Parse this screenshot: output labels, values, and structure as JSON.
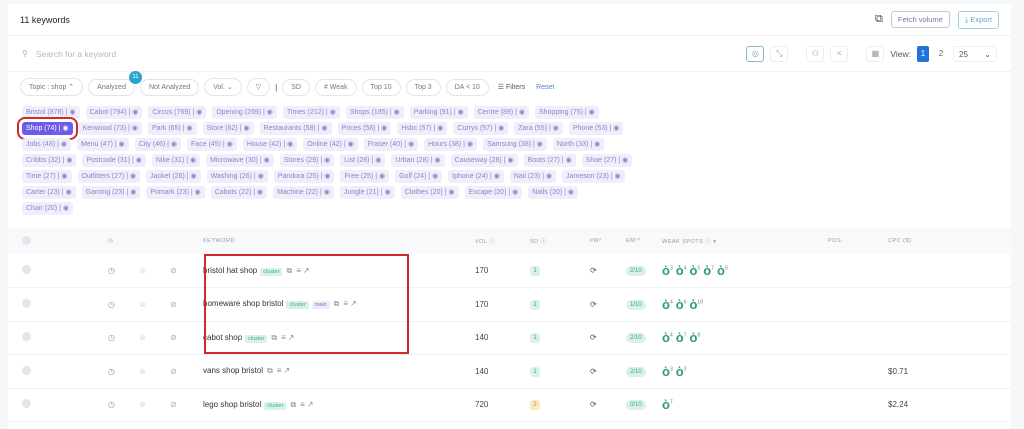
{
  "header": {
    "title": "11 keywords",
    "fetch_volume": "Fetch volume",
    "export": "Export"
  },
  "search": {
    "placeholder": "Search for a keyword"
  },
  "view": {
    "label": "View:",
    "pages": [
      "1",
      "2"
    ],
    "page_size": "25"
  },
  "filters": {
    "topic": "Topic : shop",
    "analyzed": "Analyzed",
    "analyzed_count": "11",
    "not_analyzed": "Not Analyzed",
    "vol": "Vol.",
    "sd": "SD",
    "weak": "# Weak",
    "top10": "Top 10",
    "top3": "Top 3",
    "da": "DA < 10",
    "filters": "Filters",
    "reset": "Reset"
  },
  "tags": [
    "Bristol (878) |",
    "Cabot (794) |",
    "Circus (769) |",
    "Opening (269) |",
    "Times (212) |",
    "Shops (185) |",
    "Parking (91) |",
    "Centre (89) |",
    "Shopping (75) |",
    "Shop (74) |",
    "Kenwood (73) |",
    "Park (65) |",
    "Store (62) |",
    "Restaurants (58) |",
    "Prices (58) |",
    "Hsbc (57) |",
    "Currys (57) |",
    "Zara (55) |",
    "Phone (53) |",
    "Jobs (48) |",
    "Menu (47) |",
    "City (46) |",
    "Face (45) |",
    "House (42) |",
    "Online (42) |",
    "Fraser (40) |",
    "Hours (38) |",
    "Samsung (38) |",
    "North (33) |",
    "Cribbs (32) |",
    "Postcode (31) |",
    "Nike (31) |",
    "Microwave (30) |",
    "Stores (29) |",
    "List (28) |",
    "Urban (28) |",
    "Causeway (28) |",
    "Boots (27) |",
    "Shoe (27) |",
    "Time (27) |",
    "Outfitters (27) |",
    "Jacket (26) |",
    "Washing (26) |",
    "Pandora (25) |",
    "Free (25) |",
    "Golf (24) |",
    "Iphone (24) |",
    "Nail (23) |",
    "Jameson (23) |",
    "Carter (23) |",
    "Gaming (23) |",
    "Primark (23) |",
    "Cabots (22) |",
    "Machine (22) |",
    "Jungle (21) |",
    "Clothes (20) |",
    "Escape (20) |",
    "Nails (20) |",
    "Chair (20) |"
  ],
  "active_tag": "Shop (74) |",
  "table": {
    "columns": {
      "keyword": "KEYWORD",
      "vol": "VOL ⓘ",
      "sd": "SD ⓘ",
      "w": "#W³",
      "em": "EM¹⁰",
      "weak_spots": "WEAK SPOTS ⓘ ▾",
      "pos": "POS.",
      "cpc": "CPC ($)"
    },
    "rows": [
      {
        "keyword": "bristol hat shop",
        "cluster": "cluster",
        "main": "",
        "vol": "170",
        "sd": "1",
        "sd_color": "#d8f3e6",
        "em": "2/10",
        "weak": [
          "3",
          "4",
          "5",
          "7",
          "9"
        ],
        "cpc": ""
      },
      {
        "keyword": "homeware shop bristol",
        "cluster": "cluster",
        "main": "main",
        "vol": "170",
        "sd": "1",
        "sd_color": "#d8f3e6",
        "em": "1/10",
        "weak": [
          "4",
          "6",
          "10"
        ],
        "cpc": ""
      },
      {
        "keyword": "cabot shop",
        "cluster": "cluster",
        "main": "",
        "vol": "140",
        "sd": "1",
        "sd_color": "#d8f3e6",
        "em": "2/10",
        "weak": [
          "4",
          "7",
          "8"
        ],
        "cpc": ""
      },
      {
        "keyword": "vans shop bristol",
        "cluster": "",
        "main": "",
        "vol": "140",
        "sd": "1",
        "sd_color": "#d8f3e6",
        "em": "2/10",
        "weak": [
          "3",
          "3"
        ],
        "cpc": "$0.71"
      },
      {
        "keyword": "lego shop bristol",
        "cluster": "cluster",
        "main": "",
        "vol": "720",
        "sd": "2",
        "sd_color": "#fbe7c2",
        "em": "0/10",
        "weak": [
          "7"
        ],
        "cpc": "$2.24"
      }
    ]
  }
}
